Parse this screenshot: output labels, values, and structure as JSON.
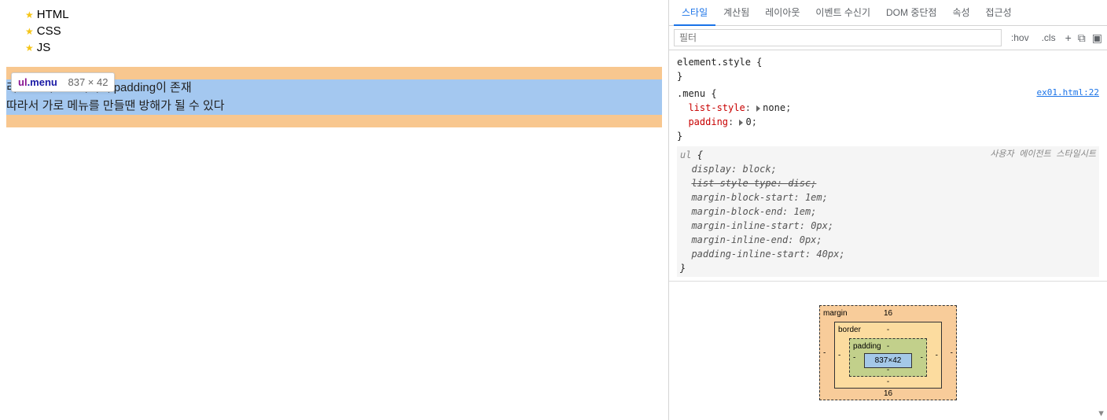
{
  "list": {
    "items": [
      "HTML",
      "CSS",
      "JS"
    ]
  },
  "tooltip": {
    "tag": "ul",
    "cls": ".menu",
    "dims": "837 × 42"
  },
  "highlighted": {
    "line1": "리스트 태그는 좌측에 padding이 존재",
    "line2": "따라서 가로 메뉴를 만들땐 방해가 될 수 있다"
  },
  "tabs": {
    "styles": "스타일",
    "computed": "계산됨",
    "layout": "레이아웃",
    "listeners": "이벤트 수신기",
    "dom": "DOM 중단점",
    "props": "속성",
    "a11y": "접근성"
  },
  "filter": {
    "placeholder": "필터",
    "hov": ":hov",
    "cls": ".cls"
  },
  "rules": {
    "element_style": "element.style",
    "menu": {
      "selector": ".menu",
      "source": "ex01.html:22",
      "p1_name": "list-style",
      "p1_val": "none",
      "p2_name": "padding",
      "p2_val": "0"
    },
    "ua": {
      "selector": "ul",
      "label": "사용자 에이전트 스타일시트",
      "p1_name": "display",
      "p1_val": "block",
      "p2_name": "list-style-type",
      "p2_val": "disc",
      "p3_name": "margin-block-start",
      "p3_val": "1em",
      "p4_name": "margin-block-end",
      "p4_val": "1em",
      "p5_name": "margin-inline-start",
      "p5_val": "0px",
      "p6_name": "margin-inline-end",
      "p6_val": "0px",
      "p7_name": "padding-inline-start",
      "p7_val": "40px"
    }
  },
  "box": {
    "margin_label": "margin",
    "border_label": "border",
    "padding_label": "padding",
    "margin_top": "16",
    "margin_bottom": "16",
    "margin_left": "-",
    "margin_right": "-",
    "border_all": "-",
    "padding_all": "-",
    "content": "837×42"
  }
}
